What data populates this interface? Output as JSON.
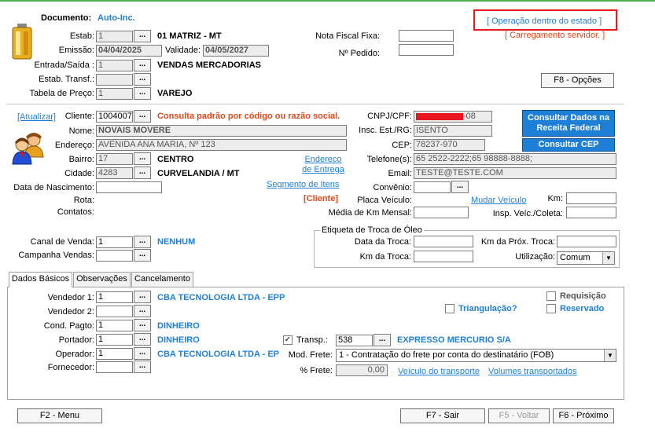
{
  "header": {
    "documento_label": "Documento:",
    "documento_value": "Auto-Inc.",
    "operacao": "[ Operação dentro do estado ]",
    "carregamento": "[ Carregamento servidor. ]",
    "estab_label": "Estab:",
    "estab_value": "1",
    "estab_name": "01 MATRIZ - MT",
    "emissao_label": "Emissão:",
    "emissao_value": "04/04/2025",
    "validade_label": "Validade:",
    "validade_value": "04/05/2027",
    "entrada_label": "Entrada/Saída :",
    "entrada_value": "1",
    "entrada_name": "VENDAS MERCADORIAS",
    "estab_transf_label": "Estab. Transf.:",
    "tabela_label": "Tabela de Preço:",
    "tabela_value": "1",
    "tabela_name": "VAREJO",
    "nota_label": "Nota Fiscal Fixa:",
    "pedido_label": "Nº Pedido:",
    "f8_label": "F8 - Opções"
  },
  "cliente": {
    "atualizar": "[Atualizar]",
    "cliente_label": "Cliente:",
    "cliente_value": "1004007:",
    "consulta_hint": "Consulta padrão por código ou razão social.",
    "nome_label": "Nome:",
    "nome_value": "NOVAIS MOVERE",
    "endereco_label": "Endereço:",
    "endereco_value": "AVENIDA ANA MARIA, Nº 123",
    "bairro_label": "Bairro:",
    "bairro_value": "17",
    "bairro_name": "CENTRO",
    "cidade_label": "Cidade:",
    "cidade_value": "4283",
    "cidade_name": "CURVELANDIA / MT",
    "nascimento_label": "Data de Nascimento:",
    "rota_label": "Rota:",
    "contatos_label": "Contatos:",
    "endereco_entrega": "Endereco de Entrega",
    "segmento": "Segmento de Itens",
    "cliente_tag": "[Cliente]",
    "cnpj_label": "CNPJ/CPF:",
    "cnpj_suffix": "-08",
    "insc_label": "Insc. Est./RG:",
    "insc_value": "ISENTO",
    "cep_label": "CEP:",
    "cep_value": "78237-970",
    "telefone_label": "Telefone(s):",
    "telefone_value": "65 2522-2222;65 98888-8888;",
    "email_label": "Email:",
    "email_value": "TESTE@TESTE.COM",
    "convenio_label": "Convênio:",
    "placa_label": "Placa Veículo:",
    "mudar_veiculo": "Mudar Veículo",
    "km_label": "Km:",
    "media_label": "Média de Km Mensal:",
    "insp_label": "Insp. Veíc./Coleta:",
    "consultar_receita": "Consultar Dados na Receita Federal",
    "consultar_cep": "Consultar CEP"
  },
  "venda": {
    "canal_label": "Canal de Venda:",
    "canal_value": "1",
    "canal_name": "NENHUM",
    "campanha_label": "Campanha Vendas:",
    "etiqueta_title": "Etiqueta de Troca de Óleo",
    "data_troca_label": "Data da Troca:",
    "km_prox_label": "Km da Próx. Troca:",
    "km_troca_label": "Km da Troca:",
    "utilizacao_label": "Utilização:",
    "utilizacao_value": "Comum"
  },
  "tabs": [
    "Dados Básicos",
    "Observações",
    "Cancelamento"
  ],
  "basicos": {
    "vendedor1_label": "Vendedor 1:",
    "vendedor1_value": "1",
    "vendedor1_name": "CBA TECNOLOGIA LTDA - EPP",
    "vendedor2_label": "Vendedor 2:",
    "cond_label": "Cond. Pagto:",
    "cond_value": "1",
    "cond_name": "DINHEIRO",
    "portador_label": "Portador:",
    "portador_value": "1",
    "portador_name": "DINHEIRO",
    "operador_label": "Operador:",
    "operador_value": "1",
    "operador_name": "CBA TECNOLOGIA LTDA - EP",
    "fornecedor_label": "Fornecedor:",
    "requisicao": "Requisição",
    "triangulacao": "Triangulação?",
    "reservado": "Reservado",
    "transp_label": "Transp.:",
    "transp_value": "538",
    "transp_name": "EXPRESSO MERCURIO S/A",
    "modfrete_label": "Mod. Frete:",
    "modfrete_value": "1 - Contratação do frete por conta do destinatário (FOB)",
    "pfrete_label": "% Frete:",
    "pfrete_value": "0,00",
    "veiculo_transporte": "Veículo do transporte",
    "volumes": "Volumes transportados"
  },
  "footer": {
    "f2": "F2 - Menu",
    "f7": "F7 - Sair",
    "f5": "F5 - Voltar",
    "f6": "F6 - Próximo"
  },
  "colors": {
    "accent": "#1f7fd6",
    "warning": "#e0491a",
    "highlight_box": "#e8141e"
  }
}
